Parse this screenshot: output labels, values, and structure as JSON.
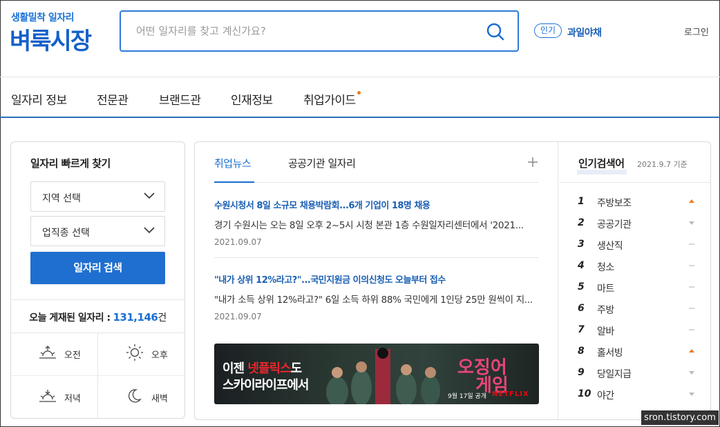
{
  "header": {
    "logo_sub": "생활밀착 일자리",
    "logo_main": "벼룩시장",
    "search_placeholder": "어떤 일자리를 찾고 계신가요?",
    "popular_badge": "인기",
    "popular_term": "과일야채",
    "login": "로그인"
  },
  "nav": {
    "items": [
      "일자리 정보",
      "전문관",
      "브랜드관",
      "인재정보",
      "취업가이드"
    ]
  },
  "quick": {
    "title": "일자리 빠르게 찾기",
    "region_select": "지역 선택",
    "job_select": "업직종 선택",
    "search_button": "일자리 검색",
    "today_label": "오늘 게재된 일자리 :",
    "today_count": "131,146",
    "today_unit": "건",
    "times": [
      "오전",
      "오후",
      "저녁",
      "새벽"
    ]
  },
  "news": {
    "tabs": [
      "취업뉴스",
      "공공기관 일자리"
    ],
    "items": [
      {
        "title": "수원시청서 8일 소규모 채용박람회...6개 기업이 18명 채용",
        "desc": "경기 수원시는 오는 8일 오후 2~5시 시청 본관 1층 수원일자리센터에서 '2021...",
        "date": "2021.09.07"
      },
      {
        "title": "\"내가 상위 12%라고?\"...국민지원금 이의신청도 오늘부터 접수",
        "desc": "\"내가 소득 상위 12%라고?\" 6일 소득 하위 88% 국민에게 1인당 25만 원씩이 지...",
        "date": "2021.09.07"
      }
    ],
    "banner": {
      "line1_pre": "이젠 ",
      "line1_red": "넷플릭스",
      "line1_post": "도",
      "line2": "스카이라이프에서",
      "game1": "오징어",
      "game2": "게임",
      "date_text": "9월 17일 공개",
      "brand": "NETFLIX"
    }
  },
  "popular": {
    "title": "인기검색어",
    "date": "2021.9.7 기준",
    "items": [
      {
        "rank": "1",
        "term": "주방보조",
        "change": "up"
      },
      {
        "rank": "2",
        "term": "공공기관",
        "change": "down"
      },
      {
        "rank": "3",
        "term": "생산직",
        "change": "same"
      },
      {
        "rank": "4",
        "term": "청소",
        "change": "same"
      },
      {
        "rank": "5",
        "term": "마트",
        "change": "same"
      },
      {
        "rank": "6",
        "term": "주방",
        "change": "same"
      },
      {
        "rank": "7",
        "term": "알바",
        "change": "same"
      },
      {
        "rank": "8",
        "term": "홀서빙",
        "change": "up"
      },
      {
        "rank": "9",
        "term": "당일지급",
        "change": "down"
      },
      {
        "rank": "10",
        "term": "야간",
        "change": "down"
      }
    ]
  },
  "watermark": "sron.tistory.com",
  "colors": {
    "brand_blue": "#1a6fd0",
    "up": "#f27a1a",
    "down": "#bbbbbb"
  }
}
